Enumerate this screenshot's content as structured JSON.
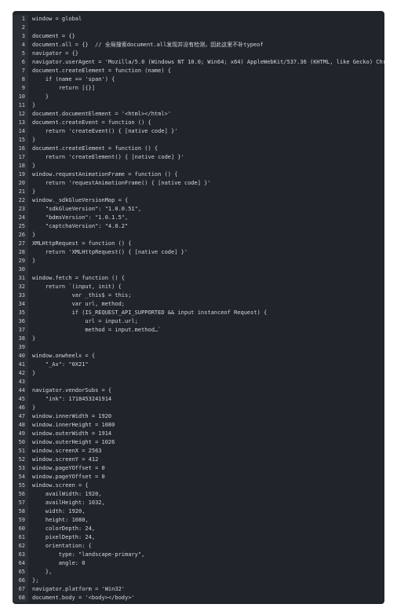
{
  "editor": {
    "lines": [
      "window = global",
      "",
      "document = {}",
      "document.all = {}  // 全局搜索document.all发现并没有检测，因此这里不补typeof",
      "navigator = {}",
      "navigator.userAgent = 'Mozilla/5.0 (Windows NT 10.0; Win64; x64) AppleWebKit/537.36 (KHTML, like Gecko) Chrome/126.0",
      "document.createElement = function (name) {",
      "    if (name == 'span') {",
      "        return [{}]",
      "    }",
      "}",
      "document.documentElement = '<html></html>'",
      "document.createEvent = function () {",
      "    return 'createEvent() { [native code] }'",
      "}",
      "document.createElement = function () {",
      "    return 'createElement() { [native code] }'",
      "}",
      "window.requestAnimationFrame = function () {",
      "    return 'requestAnimationFrame() { [native code] }'",
      "}",
      "window._sdkGlueVersionMap = {",
      "    \"sdkGlueVersion\": \"1.0.0.51\",",
      "    \"bdmsVersion\": \"1.0.1.5\",",
      "    \"captchaVersion\": \"4.0.2\"",
      "}",
      "XMLHttpRequest = function () {",
      "    return 'XMLHttpRequest() { [native code] }'",
      "}",
      "",
      "window.fetch = function () {",
      "    return `(input, init) {",
      "            var _this$ = this;",
      "            var url, method;",
      "            if (IS_REQUEST_API_SUPPORTED && input instanceof Request) {",
      "                url = input.url;",
      "                method = input.method…`",
      "}",
      "",
      "window.onwheelx = {",
      "    \"_Ax\": \"0X21\"",
      "}",
      "",
      "navigator.vendorSubs = {",
      "    \"ink\": 1718453241914",
      "}",
      "window.innerWidth = 1920",
      "window.innerHeight = 1080",
      "window.outerWidth = 1914",
      "window.outerHeight = 1026",
      "window.screenX = 2563",
      "window.screenY = 412",
      "window.pageYOffset = 0",
      "window.pageYOffset = 0",
      "window.screen = {",
      "    availWidth: 1920,",
      "    availHeight: 1032,",
      "    width: 1920,",
      "    height: 1080,",
      "    colorDepth: 24,",
      "    pixelDepth: 24,",
      "    orientation: {",
      "        type: \"landscape-primary\",",
      "        angle: 0",
      "    },",
      "};",
      "navigator.platform = 'Win32'",
      "document.body = '<body></body>'"
    ]
  },
  "colors": {
    "background": "#21252b",
    "gutter": "#2a2e35",
    "text": "#d4d7dd"
  }
}
